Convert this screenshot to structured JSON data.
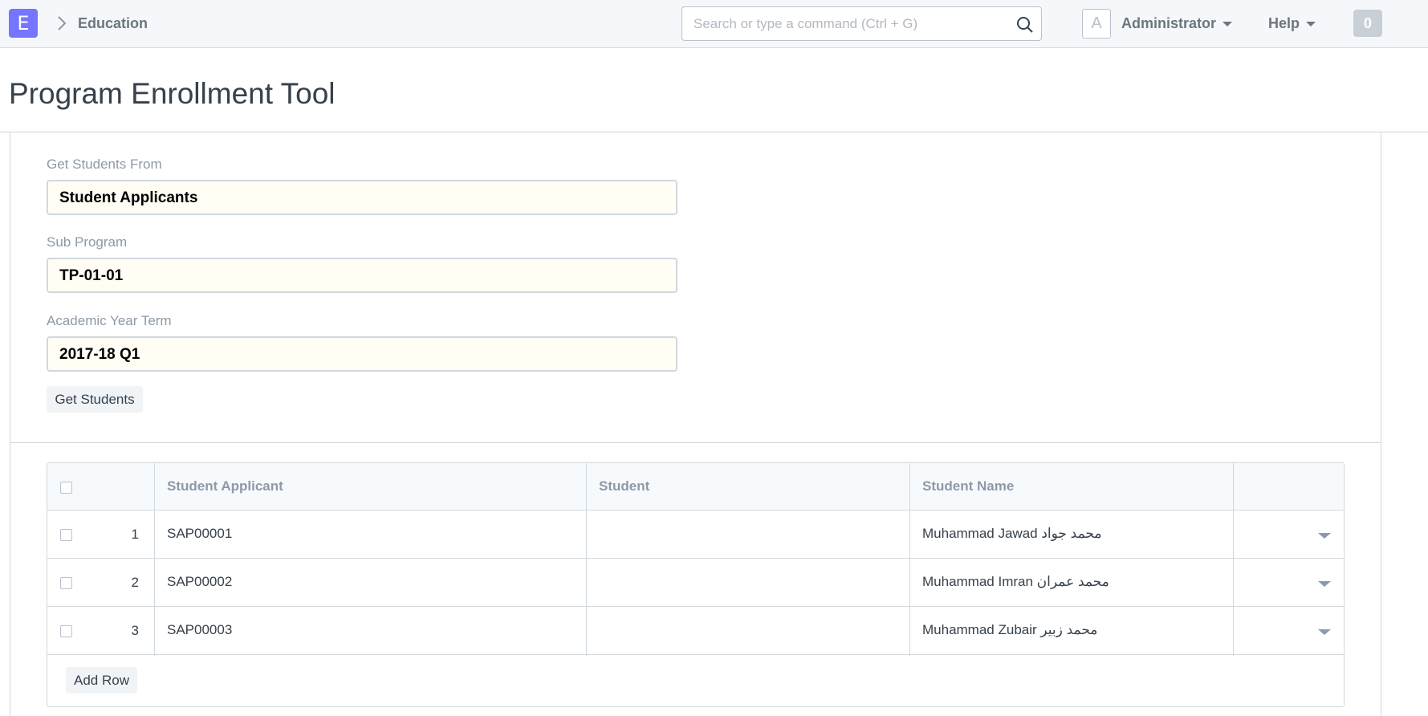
{
  "navbar": {
    "logo_letter": "E",
    "breadcrumb": "Education",
    "search_placeholder": "Search or type a command (Ctrl + G)",
    "avatar_letter": "A",
    "user_label": "Administrator",
    "help_label": "Help",
    "notification_count": "0"
  },
  "page": {
    "title": "Program Enrollment Tool"
  },
  "form": {
    "get_students_from": {
      "label": "Get Students From",
      "value": "Student Applicants"
    },
    "sub_program": {
      "label": "Sub Program",
      "value": "TP-01-01"
    },
    "academic_year_term": {
      "label": "Academic Year Term",
      "value": "2017-18 Q1"
    },
    "get_students_button": "Get Students"
  },
  "grid": {
    "headers": [
      "Student Applicant",
      "Student",
      "Student Name"
    ],
    "rows": [
      {
        "no": "1",
        "student_applicant": "SAP00001",
        "student": "",
        "student_name": "Muhammad Jawad محمد جواد"
      },
      {
        "no": "2",
        "student_applicant": "SAP00002",
        "student": "",
        "student_name": "Muhammad Imran محمد عمران"
      },
      {
        "no": "3",
        "student_applicant": "SAP00003",
        "student": "",
        "student_name": "Muhammad Zubair محمد زبير"
      }
    ],
    "add_row_button": "Add Row"
  }
}
